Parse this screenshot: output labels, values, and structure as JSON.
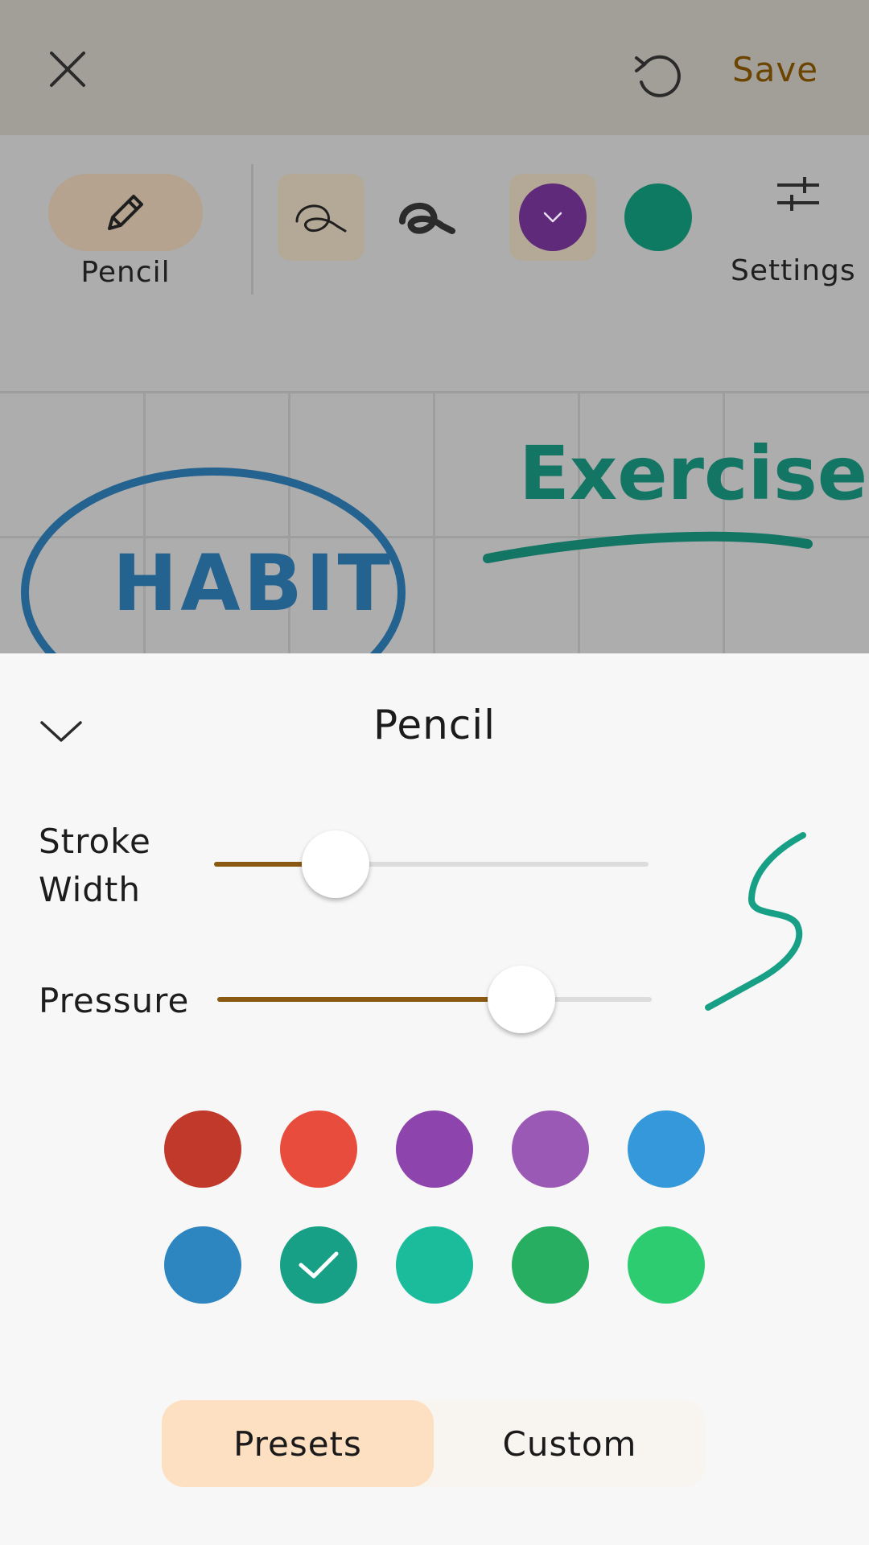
{
  "header": {
    "save_label": "Save",
    "close_icon": "close-icon",
    "undo_icon": "undo-icon"
  },
  "toolbar": {
    "pencil_label": "Pencil",
    "settings_label": "Settings",
    "selected_color": "#5f2a7a",
    "second_color": "#0f7a62"
  },
  "canvas": {
    "texts": [
      "HABIT",
      "Exercise"
    ],
    "ink_colors": {
      "habit": "#24628f",
      "exercise": "#137564"
    }
  },
  "sheet": {
    "title": "Pencil",
    "stroke_width_label_line1": "Stroke",
    "stroke_width_label_line2": "Width",
    "pressure_label": "Pressure",
    "stroke_width_value": 0.28,
    "pressure_value": 0.7,
    "accent": "#8b5a12",
    "palette": [
      "#c0392b",
      "#e74c3c",
      "#8e44ad",
      "#9b59b6",
      "#3498db",
      "#2e86c1",
      "#17a085",
      "#1abc9c",
      "#27ae60",
      "#2ecc71"
    ],
    "selected_palette_index": 6,
    "segments": {
      "presets": "Presets",
      "custom": "Custom",
      "active": "presets"
    }
  }
}
